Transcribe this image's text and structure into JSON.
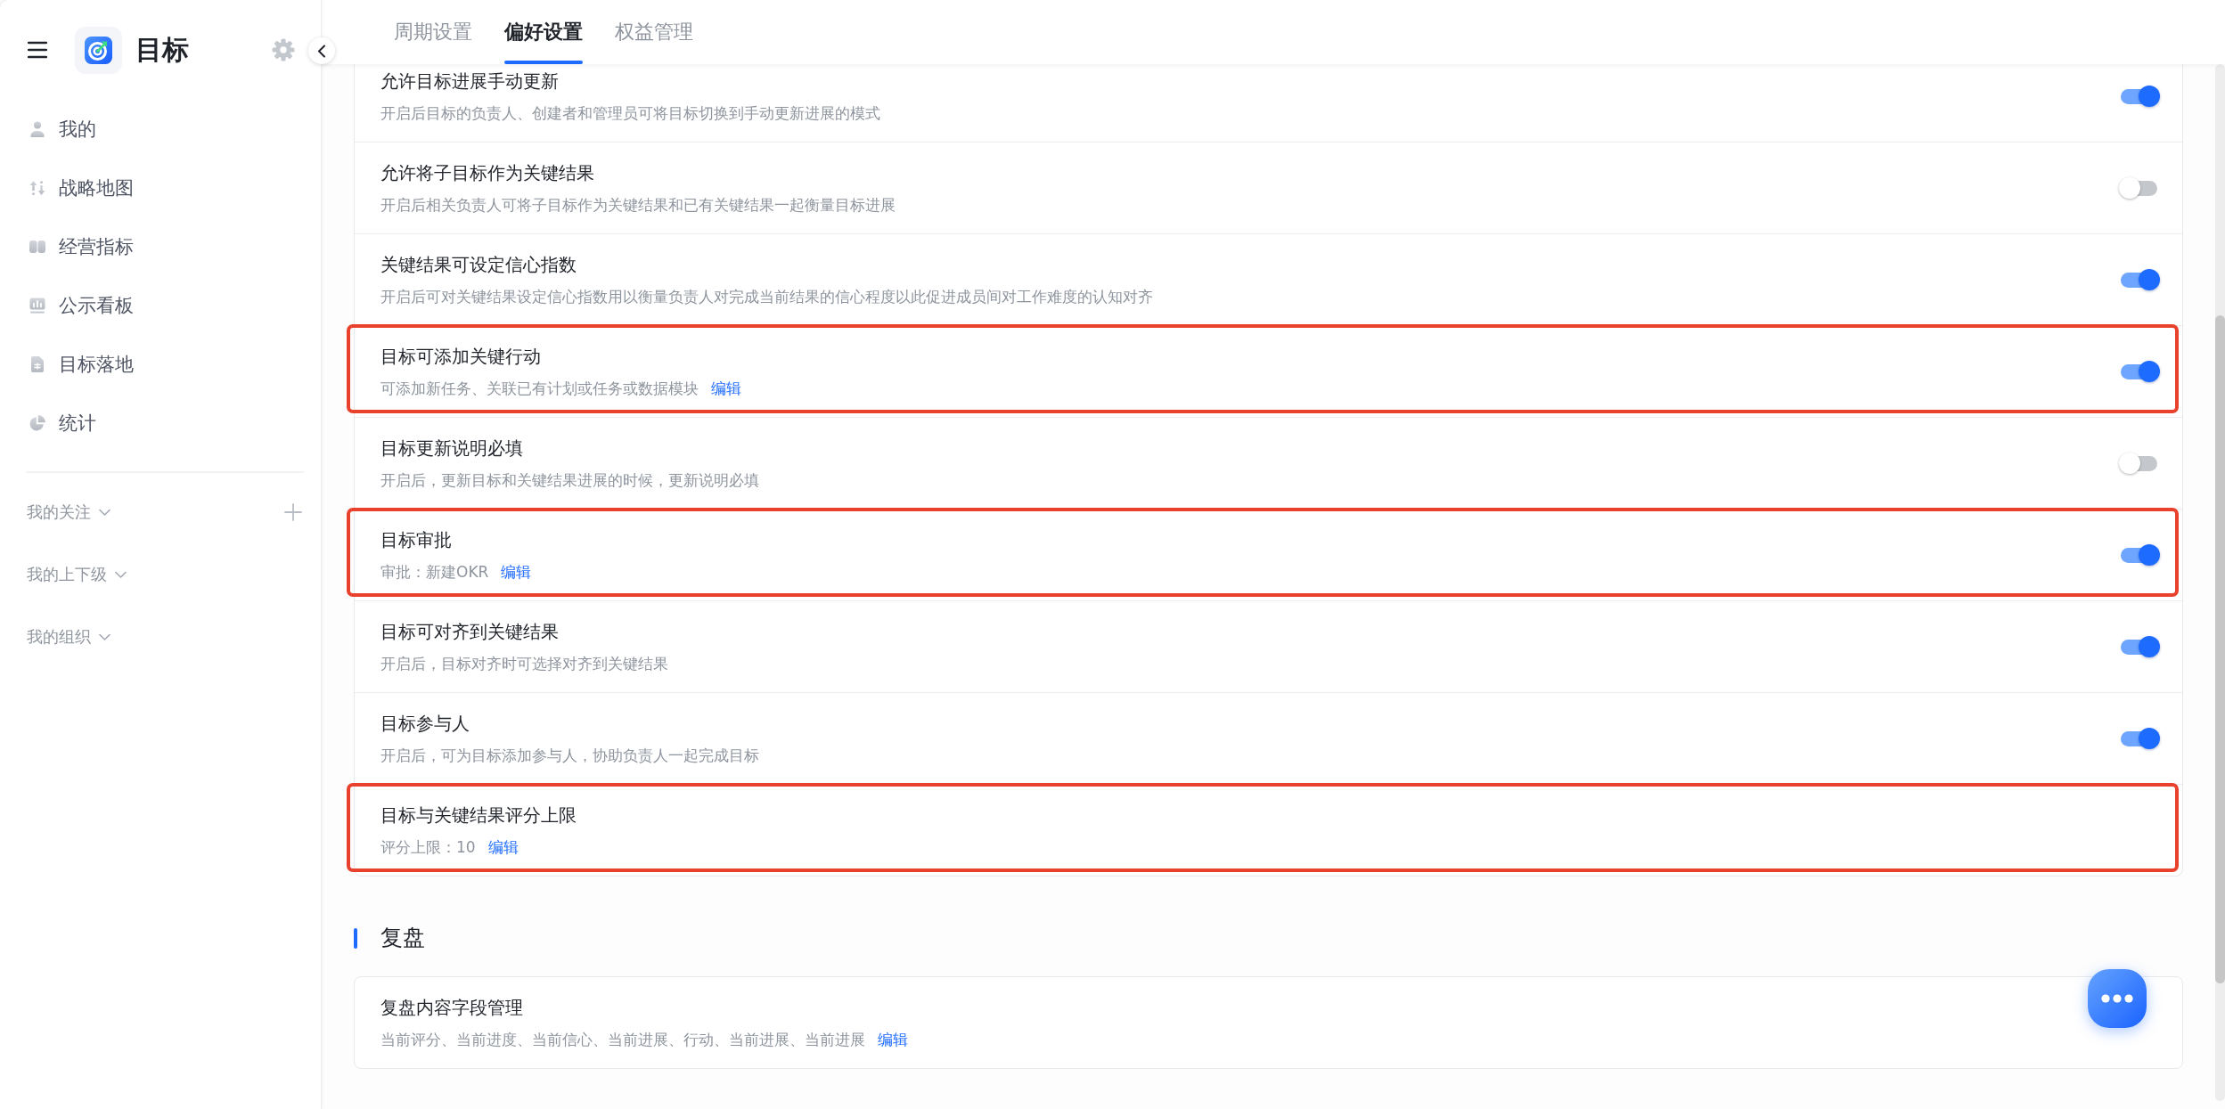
{
  "sidebar": {
    "title": "目标",
    "nav_items": [
      {
        "label": "我的",
        "selected": false
      },
      {
        "label": "战略地图",
        "selected": false
      },
      {
        "label": "经营指标",
        "selected": false
      },
      {
        "label": "公示看板",
        "selected": false
      },
      {
        "label": "目标落地",
        "selected": false
      },
      {
        "label": "统计",
        "selected": false
      }
    ],
    "groups": [
      {
        "label": "我的关注",
        "addable": true
      },
      {
        "label": "我的上下级",
        "addable": false
      },
      {
        "label": "我的组织",
        "addable": false
      }
    ]
  },
  "tabs": [
    {
      "label": "周期设置",
      "selected": false
    },
    {
      "label": "偏好设置",
      "selected": true
    },
    {
      "label": "权益管理",
      "selected": false
    }
  ],
  "settings": [
    {
      "kind": "toggle",
      "title": "允许目标进展手动更新",
      "description": "开启后目标的负责人、创建者和管理员可将目标切换到手动更新进展的模式",
      "on": true,
      "highlighted": false
    },
    {
      "kind": "toggle",
      "title": "允许将子目标作为关键结果",
      "description": "开启后相关负责人可将子目标作为关键结果和已有关键结果一起衡量目标进展",
      "on": false,
      "highlighted": false
    },
    {
      "kind": "toggle",
      "title": "关键结果可设定信心指数",
      "description": "开启后可对关键结果设定信心指数用以衡量负责人对完成当前结果的信心程度以此促进成员间对工作难度的认知对齐",
      "on": true,
      "highlighted": false
    },
    {
      "kind": "toggle",
      "title": "目标可添加关键行动",
      "description": "可添加新任务、关联已有计划或任务或数据模块",
      "link": "编辑",
      "on": true,
      "highlighted": true
    },
    {
      "kind": "toggle",
      "title": "目标更新说明必填",
      "description": "开启后，更新目标和关键结果进展的时候，更新说明必填",
      "on": false,
      "highlighted": false
    },
    {
      "kind": "toggle",
      "title": "目标审批",
      "description": "审批：新建OKR",
      "link": "编辑",
      "on": true,
      "highlighted": true
    },
    {
      "kind": "toggle",
      "title": "目标可对齐到关键结果",
      "description": "开启后，目标对齐时可选择对齐到关键结果",
      "on": true,
      "highlighted": false
    },
    {
      "kind": "toggle",
      "title": "目标参与人",
      "description": "开启后，可为目标添加参与人，协助负责人一起完成目标",
      "on": true,
      "highlighted": false
    },
    {
      "kind": "plain",
      "title": "目标与关键结果评分上限",
      "description": "评分上限：10",
      "link": "编辑",
      "highlighted": true
    }
  ],
  "sections": [
    {
      "heading": "复盘",
      "settings": [
        {
          "kind": "plain",
          "title": "复盘内容字段管理",
          "description": "当前评分、当前进度、当前信心、当前进展、行动、当前进展、当前进展",
          "link": "编辑",
          "highlighted": false
        }
      ]
    }
  ]
}
